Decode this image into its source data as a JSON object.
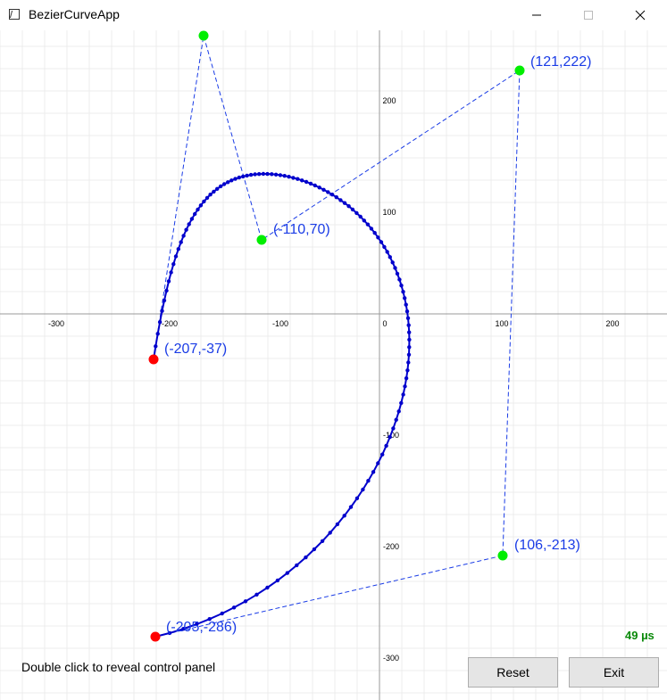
{
  "window": {
    "title": "BezierCurveApp"
  },
  "axis": {
    "x_ticks": [
      "-300",
      "-200",
      "-100",
      "0",
      "100",
      "200"
    ],
    "y_ticks": [
      "200",
      "100",
      "-100",
      "-200",
      "-300"
    ]
  },
  "points": {
    "p0": {
      "label": "(-207,-37)",
      "color": "#ff0000"
    },
    "p1": {
      "label": "(-110,70)",
      "color": "#00ee00"
    },
    "p3": {
      "label": "(121,222)",
      "color": "#00ee00"
    },
    "p4": {
      "label": "(106,-213)",
      "color": "#00ee00"
    },
    "p5": {
      "label": "(-205,-286)",
      "color": "#ff0000"
    }
  },
  "curve_color": "#0000cc",
  "status": {
    "timing": "49 µs",
    "hint": "Double click to reveal control panel"
  },
  "buttons": {
    "reset": "Reset",
    "exit": "Exit"
  }
}
